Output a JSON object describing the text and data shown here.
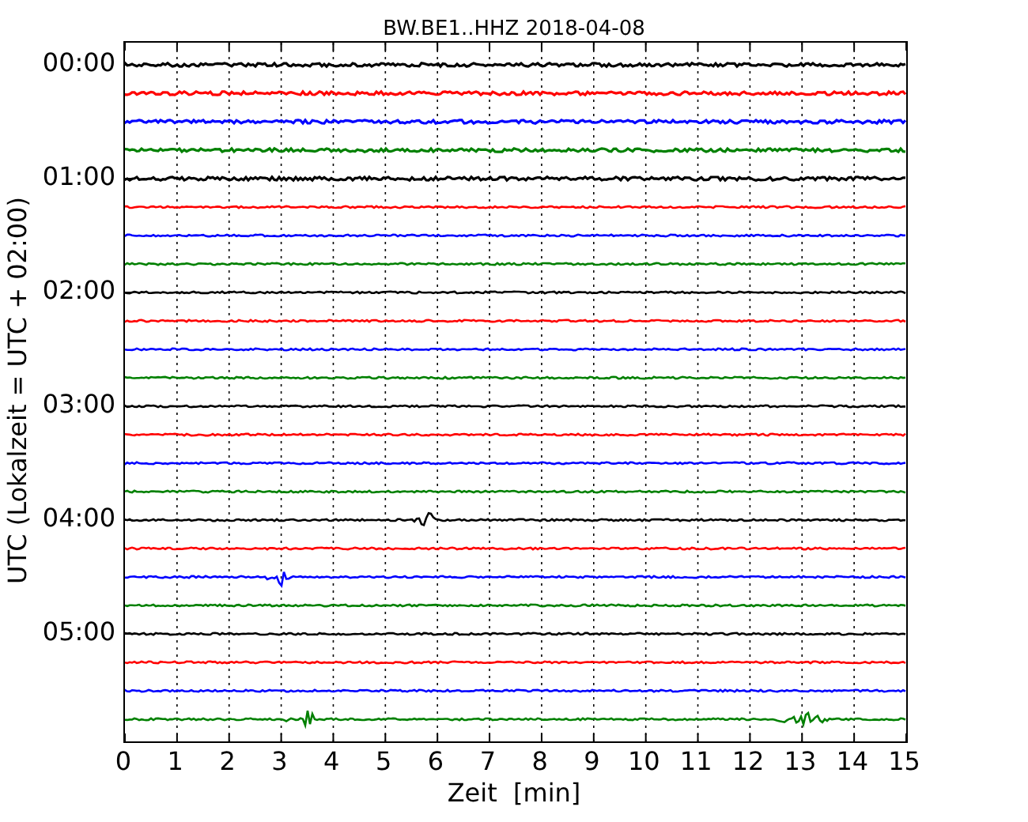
{
  "title": "BW.BE1..HHZ 2018-04-08",
  "ylabel": "UTC (Lokalzeit = UTC + 02:00)",
  "xlabel": "Zeit  [min]",
  "y_ticks": [
    "00:00",
    "01:00",
    "02:00",
    "03:00",
    "04:00",
    "05:00"
  ],
  "x_ticks": [
    "0",
    "1",
    "2",
    "3",
    "4",
    "5",
    "6",
    "7",
    "8",
    "9",
    "10",
    "11",
    "12",
    "13",
    "14",
    "15"
  ],
  "traces": [
    {
      "color": "#000000"
    },
    {
      "color": "#ff0000"
    },
    {
      "color": "#0000ff"
    },
    {
      "color": "#008000"
    },
    {
      "color": "#000000"
    },
    {
      "color": "#ff0000"
    },
    {
      "color": "#0000ff"
    },
    {
      "color": "#008000"
    },
    {
      "color": "#000000"
    },
    {
      "color": "#ff0000"
    },
    {
      "color": "#0000ff"
    },
    {
      "color": "#008000"
    },
    {
      "color": "#000000"
    },
    {
      "color": "#ff0000"
    },
    {
      "color": "#0000ff"
    },
    {
      "color": "#008000"
    },
    {
      "color": "#000000"
    },
    {
      "color": "#ff0000"
    },
    {
      "color": "#0000ff"
    },
    {
      "color": "#008000"
    },
    {
      "color": "#000000"
    },
    {
      "color": "#ff0000"
    },
    {
      "color": "#0000ff"
    },
    {
      "color": "#008000"
    }
  ]
}
